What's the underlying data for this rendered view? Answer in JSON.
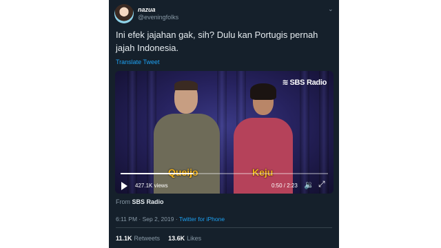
{
  "tweet": {
    "display_name": "nazua",
    "handle": "@eveningfolks",
    "text": "Ini efek jajahan gak, sih? Dulu kan Portugis pernah jajah Indonesia.",
    "translate_label": "Translate Tweet",
    "from_label": "From",
    "from_source": "SBS Radio",
    "time": "6:11 PM",
    "date": "Sep 2, 2019",
    "client": "Twitter for iPhone",
    "retweets_count": "11.1K",
    "retweets_label": "Retweets",
    "likes_count": "13.6K",
    "likes_label": "Likes"
  },
  "video": {
    "brand": "SBS Radio",
    "caption_left": "Queijo",
    "caption_right": "Keju",
    "views": "427.1K views",
    "time": "0:50 / 2:23",
    "progress_fraction": 0.35
  },
  "icons": {
    "more": "chevron-down",
    "play": "play",
    "volume": "speaker",
    "fullscreen": "expand"
  },
  "colors": {
    "background": "#15202b",
    "accent": "#1da1f2",
    "caption": "#f2b21a"
  }
}
